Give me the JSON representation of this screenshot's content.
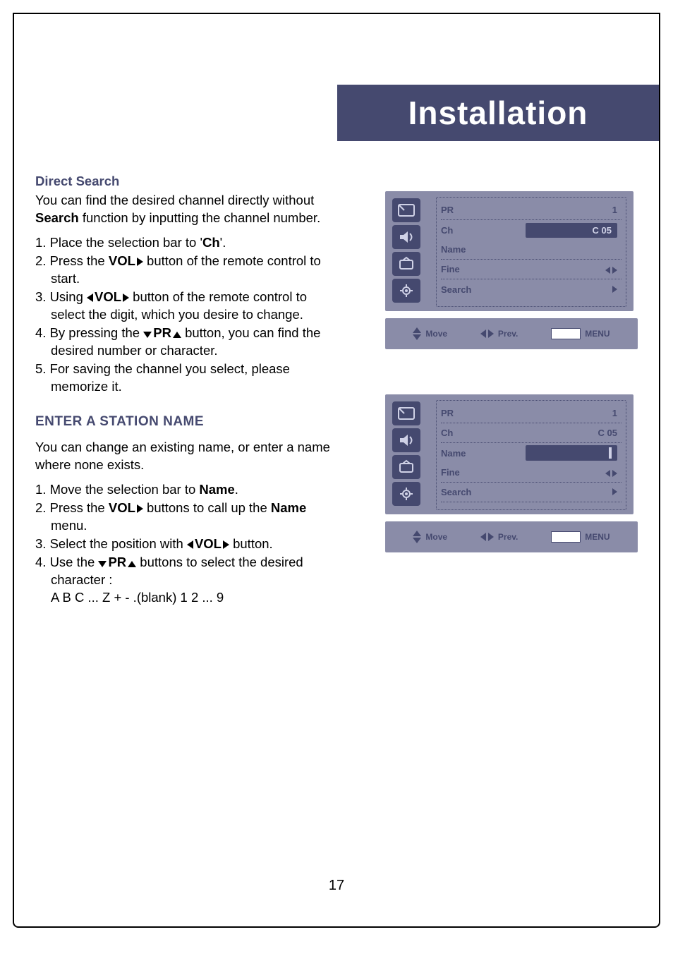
{
  "banner": {
    "title": "Installation"
  },
  "directSearch": {
    "heading": "Direct Search",
    "intro_before_search": "You can find the desired channel directly without ",
    "intro_search": "Search",
    "intro_after_search": " function by inputting the channel number.",
    "step1_a": "1. Place the selection bar to '",
    "step1_ch": "Ch",
    "step1_b": "'.",
    "step2_a": "2. Press the ",
    "step2_vol": "VOL",
    "step2_b": " button of the remote control to start.",
    "step3_a": "3. Using ",
    "step3_vol": "VOL",
    "step3_b": " button of the remote control to select the digit, which you desire to change.",
    "step4_a": "4. By pressing the ",
    "step4_pr": "PR",
    "step4_b": " button, you can find the desired number or character.",
    "step5": "5. For saving the channel you select, please memorize it."
  },
  "stationName": {
    "heading": "ENTER A STATION NAME",
    "intro": "You can change an existing name, or enter a name where none exists.",
    "step1_a": "1. Move the selection bar to ",
    "step1_name": "Name",
    "step1_b": ".",
    "step2_a": "2. Press the ",
    "step2_vol": "VOL",
    "step2_b": " buttons to call up the ",
    "step2_name": "Name",
    "step2_c": " menu.",
    "step3_a": "3. Select the position with ",
    "step3_vol": "VOL",
    "step3_b": " button.",
    "step4_a": "4. Use the ",
    "step4_pr": "PR",
    "step4_b": " buttons to select the desired character :",
    "step4_chars": "A B C ... Z + - .(blank) 1 2 ... 9"
  },
  "osd1": {
    "labels": {
      "pr": "PR",
      "ch": "Ch",
      "name": "Name",
      "fine": "Fine",
      "search": "Search"
    },
    "values": {
      "pr": "1",
      "ch": "C 05",
      "name": "",
      "fine": ""
    }
  },
  "osd2": {
    "labels": {
      "pr": "PR",
      "ch": "Ch",
      "name": "Name",
      "fine": "Fine",
      "search": "Search"
    },
    "values": {
      "pr": "1",
      "ch": "C 05",
      "name": "",
      "fine": ""
    }
  },
  "hints": {
    "move": "Move",
    "prev": "Prev.",
    "menu": "MENU"
  },
  "page_number": "17"
}
